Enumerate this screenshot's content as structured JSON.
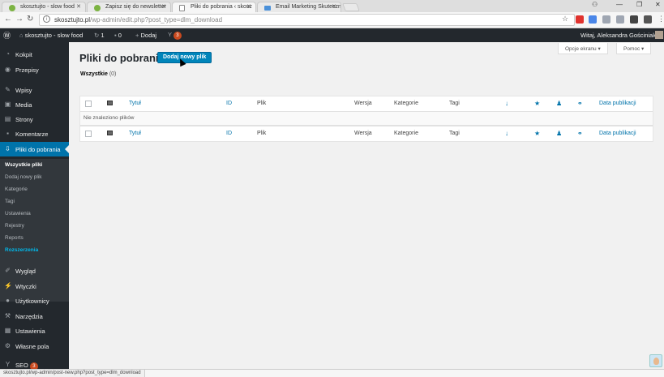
{
  "browser": {
    "tabs": [
      {
        "label": "skosztujto - slow food"
      },
      {
        "label": "Zapisz się do newsletter"
      },
      {
        "label": "Pliki do pobrania ‹ skosz"
      },
      {
        "label": "Email Marketing Skuteczn"
      }
    ],
    "url_host": "skosztujto.pl",
    "url_path": "/wp-admin/edit.php?post_type=dlm_download",
    "extensions": [
      {
        "icon": "opera-icon",
        "color": "#e0322e"
      },
      {
        "icon": "calendar-icon",
        "color": "#4a86e8"
      },
      {
        "icon": "music-icon",
        "color": "#9fa6b2"
      },
      {
        "icon": "clipboard-icon",
        "color": "#9fa6b2"
      },
      {
        "icon": "shield-icon",
        "color": "#444444"
      },
      {
        "icon": "reader-icon",
        "color": "#555555"
      },
      {
        "icon": "iq-icon",
        "color": "#4a86e8"
      }
    ],
    "status_url": "skosztujto.pl/wp-admin/post-new.php?post_type=dlm_download"
  },
  "adminbar": {
    "site_name": "skosztujto - slow food",
    "updates_count": "1",
    "comments_count": "0",
    "add_label": "Dodaj",
    "yoast_count": "3",
    "greeting": "Witaj, Aleksandra Gościniak"
  },
  "sidebar": {
    "items": [
      {
        "label": "Kokpit",
        "icon": "dashboard-icon"
      },
      {
        "label": "Przepisy",
        "icon": "recipes-icon"
      },
      {
        "label": "Wpisy",
        "icon": "pin-icon"
      },
      {
        "label": "Media",
        "icon": "media-icon"
      },
      {
        "label": "Strony",
        "icon": "pages-icon"
      },
      {
        "label": "Komentarze",
        "icon": "comments-icon"
      },
      {
        "label": "Pliki do pobrania",
        "icon": "download-icon"
      },
      {
        "label": "Wygląd",
        "icon": "brush-icon"
      },
      {
        "label": "Wtyczki",
        "icon": "plugin-icon"
      },
      {
        "label": "Użytkownicy",
        "icon": "users-icon"
      },
      {
        "label": "Narzędzia",
        "icon": "wrench-icon"
      },
      {
        "label": "Ustawienia",
        "icon": "settings-icon"
      },
      {
        "label": "Własne pola",
        "icon": "gear-icon"
      },
      {
        "label": "SEO",
        "icon": "yoast-icon",
        "badge": "3"
      }
    ],
    "submenu": [
      "Wszystkie pliki",
      "Dodaj nowy plik",
      "Kategorie",
      "Tagi",
      "Ustawienia",
      "Rejestry",
      "Reports",
      "Rozszerzenia"
    ]
  },
  "main": {
    "title": "Pliki do pobrania",
    "add_new_label": "Dodaj nowy plik",
    "screen_options_label": "Opcje ekranu",
    "help_label": "Pomoc",
    "filter_all_label": "Wszystkie",
    "filter_all_count": "(0)",
    "columns": {
      "title": "Tytuł",
      "id": "ID",
      "file": "Plik",
      "version": "Wersja",
      "categories": "Kategorie",
      "tags": "Tagi",
      "date": "Data publikacji"
    },
    "empty_message": "Nie znaleziono plików"
  }
}
